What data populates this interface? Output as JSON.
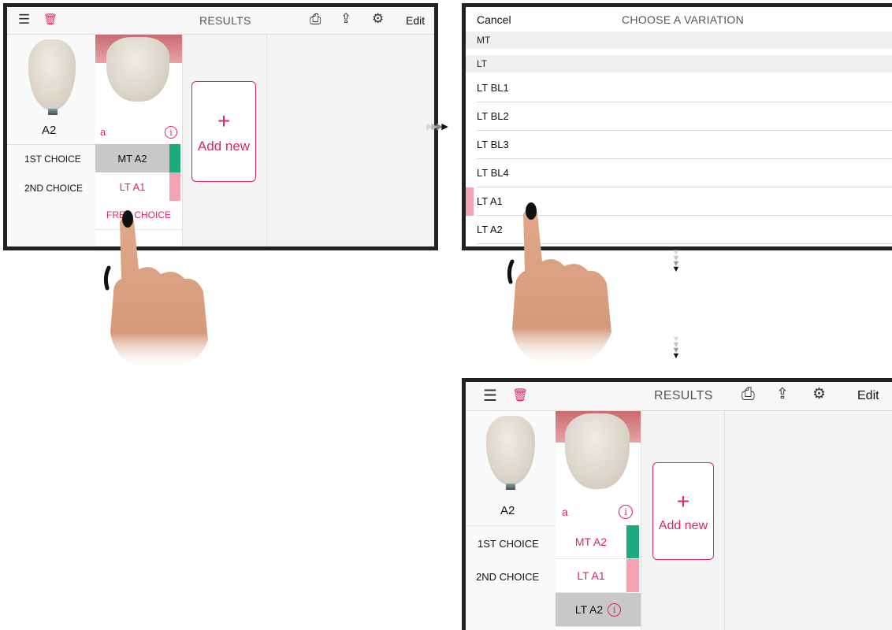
{
  "results_screen": {
    "title": "RESULTS",
    "edit_label": "Edit",
    "reference_shade": "A2",
    "sample_letter": "a",
    "info_glyph": "i",
    "add_new_label": "Add new",
    "add_glyph": "+",
    "first_choice_label": "1ST CHOICE",
    "second_choice_label": "2ND CHOICE",
    "icons": [
      "menu-icon",
      "trash-icon",
      "print-icon",
      "share-icon",
      "settings-icon"
    ],
    "icon_glyphs": {
      "menu": "☰",
      "trash": "🗑",
      "print": "⎙",
      "share": "⇪",
      "settings": "⚙"
    }
  },
  "screen_before": {
    "first_choice_value": "MT A2",
    "second_choice_value": "LT A1",
    "free_choice_label": "FREE CHOICE"
  },
  "variation_screen": {
    "cancel_label": "Cancel",
    "title": "CHOOSE A VARIATION",
    "sections": [
      "MT",
      "LT"
    ],
    "items": [
      "LT BL1",
      "LT BL2",
      "LT BL3",
      "LT BL4",
      "LT A1",
      "LT A2"
    ],
    "highlighted_item": "LT A1"
  },
  "screen_after": {
    "first_choice_value": "MT A2",
    "second_choice_value": "LT A1",
    "free_choice_value": "LT A2"
  },
  "colors": {
    "accent_pink": "#e0245e",
    "first_choice_marker": "#1aaa7e",
    "second_choice_marker": "#f4a3b3",
    "selected_cell_gray": "#c8c8c8",
    "frame_border": "#222222"
  }
}
